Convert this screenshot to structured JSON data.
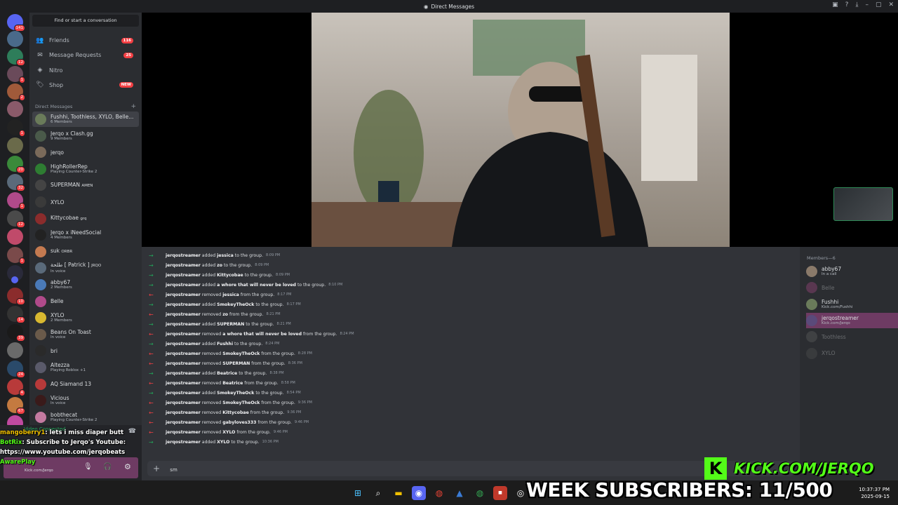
{
  "window": {
    "title": "Direct Messages"
  },
  "find_placeholder": "Find or start a conversation",
  "nav": [
    {
      "label": "Friends",
      "count": "116",
      "icon": "friends-icon"
    },
    {
      "label": "Message Requests",
      "count": "25",
      "icon": "inbox-icon"
    },
    {
      "label": "Nitro",
      "count": "",
      "icon": "nitro-icon"
    },
    {
      "label": "Shop",
      "count": "NEW",
      "icon": "shop-icon"
    }
  ],
  "dm_header": "Direct Messages",
  "dms": [
    {
      "name": "Fushhi, Toothless, XYLO, Belle...",
      "sub": "6 Members",
      "color": "#6a7b5a"
    },
    {
      "name": "Jerqo x Clash.gg",
      "sub": "9 Members",
      "color": "#4a5a4a"
    },
    {
      "name": "jerqo",
      "sub": "",
      "color": "#7a6a5a"
    },
    {
      "name": "HighRollerRep",
      "sub": "Playing Counter-Strike 2",
      "color": "#2e7d32"
    },
    {
      "name": "SUPERMAN",
      "sub": "",
      "tag": "AMEN",
      "color": "#444"
    },
    {
      "name": "XYLO",
      "sub": "",
      "color": "#3a3a3a"
    },
    {
      "name": "Kittycobae",
      "sub": "",
      "tag": "grq",
      "color": "#8b2c2c"
    },
    {
      "name": "Jerqo x iNeedSocial",
      "sub": "4 Members",
      "color": "#222"
    },
    {
      "name": "suk",
      "sub": "",
      "tag": "ORBR",
      "color": "#c47a50"
    },
    {
      "name": "ﻃﻠﺤﺔ [ Patrick ]",
      "sub": "In voice",
      "tag": "JRQO",
      "color": "#5a6a7a"
    },
    {
      "name": "abby67",
      "sub": "2 Members",
      "color": "#4a7ab8"
    },
    {
      "name": "Belle",
      "sub": "",
      "color": "#b04a8a"
    },
    {
      "name": "XYLO",
      "sub": "2 Members",
      "color": "#d8b830"
    },
    {
      "name": "Beans On Toast",
      "sub": "In voice",
      "color": "#6a5a4a"
    },
    {
      "name": "bri",
      "sub": "",
      "color": "#2a2a2a"
    },
    {
      "name": "Altezza",
      "sub": "Playing Roblox +1",
      "color": "#5a5a6a"
    },
    {
      "name": "AQ Siamand 13",
      "sub": "",
      "color": "#b83a3a"
    },
    {
      "name": "Vicious",
      "sub": "In voice",
      "color": "#3a1a1a"
    },
    {
      "name": "bobthecat",
      "sub": "Playing Counter-Strike 2",
      "color": "#c47aa0"
    }
  ],
  "guild_badges": [
    "141",
    "",
    "12",
    "1",
    "2",
    "",
    "1",
    "",
    "20",
    "32",
    "1",
    "12",
    "",
    "1",
    "",
    "",
    "10",
    "14",
    "39",
    "",
    "24",
    "4",
    "67",
    ""
  ],
  "userbar": {
    "status": "Video Connected",
    "user_sub": "Kick.com/Jerqo"
  },
  "stream_chat": [
    {
      "user": "mangoberry1",
      "msg": ": lets i miss diaper butt"
    },
    {
      "user": "BotRix",
      "msg": ": Subscribe to Jerqo's Youtube:"
    },
    {
      "user": "",
      "msg": "https://www.youtube.com/jerqobeats"
    },
    {
      "user": "AwarePlay",
      "msg": ""
    }
  ],
  "log": [
    {
      "type": "add",
      "actor": "jerqostreamer",
      "verb": "added",
      "target": "jessica",
      "rest": "to the group.",
      "time": "8:09 PM"
    },
    {
      "type": "add",
      "actor": "jerqostreamer",
      "verb": "added",
      "target": "zo",
      "rest": "to the group.",
      "time": "8:09 PM"
    },
    {
      "type": "add",
      "actor": "jerqostreamer",
      "verb": "added",
      "target": "Kittycobae",
      "rest": "to the group.",
      "time": "8:09 PM"
    },
    {
      "type": "add",
      "actor": "jerqostreamer",
      "verb": "added",
      "target": "a whore that will never be loved",
      "rest": "to the group.",
      "time": "8:10 PM"
    },
    {
      "type": "rem",
      "actor": "jerqostreamer",
      "verb": "removed",
      "target": "jessica",
      "rest": "from the group.",
      "time": "8:17 PM"
    },
    {
      "type": "add",
      "actor": "jerqostreamer",
      "verb": "added",
      "target": "SmokeyTheOck",
      "rest": "to the group.",
      "time": "8:17 PM"
    },
    {
      "type": "rem",
      "actor": "jerqostreamer",
      "verb": "removed",
      "target": "zo",
      "rest": "from the group.",
      "time": "8:21 PM"
    },
    {
      "type": "add",
      "actor": "jerqostreamer",
      "verb": "added",
      "target": "SUPERMAN",
      "rest": "to the group.",
      "time": "8:21 PM"
    },
    {
      "type": "rem",
      "actor": "jerqostreamer",
      "verb": "removed",
      "target": "a whore that will never be loved",
      "rest": "from the group.",
      "time": "8:24 PM"
    },
    {
      "type": "add",
      "actor": "jerqostreamer",
      "verb": "added",
      "target": "Fushhi",
      "rest": "to the group.",
      "time": "8:24 PM"
    },
    {
      "type": "rem",
      "actor": "jerqostreamer",
      "verb": "removed",
      "target": "SmokeyTheOck",
      "rest": "from the group.",
      "time": "8:28 PM"
    },
    {
      "type": "rem",
      "actor": "jerqostreamer",
      "verb": "removed",
      "target": "SUPERMAN",
      "rest": "from the group.",
      "time": "8:36 PM"
    },
    {
      "type": "add",
      "actor": "jerqostreamer",
      "verb": "added",
      "target": "Beatrice",
      "rest": "to the group.",
      "time": "8:38 PM"
    },
    {
      "type": "rem",
      "actor": "jerqostreamer",
      "verb": "removed",
      "target": "Beatrice",
      "rest": "from the group.",
      "time": "8:58 PM"
    },
    {
      "type": "add",
      "actor": "jerqostreamer",
      "verb": "added",
      "target": "SmokeyTheOck",
      "rest": "to the group.",
      "time": "8:54 PM"
    },
    {
      "type": "rem",
      "actor": "jerqostreamer",
      "verb": "removed",
      "target": "SmokeyTheOck",
      "rest": "from the group.",
      "time": "9:36 PM"
    },
    {
      "type": "rem",
      "actor": "jerqostreamer",
      "verb": "removed",
      "target": "Kittycobae",
      "rest": "from the group.",
      "time": "9:36 PM"
    },
    {
      "type": "rem",
      "actor": "jerqostreamer",
      "verb": "removed",
      "target": "gabyloves333",
      "rest": "from the group.",
      "time": "9:46 PM"
    },
    {
      "type": "rem",
      "actor": "jerqostreamer",
      "verb": "removed",
      "target": "XYLO",
      "rest": "from the group.",
      "time": "9:46 PM"
    },
    {
      "type": "add",
      "actor": "jerqostreamer",
      "verb": "added",
      "target": "XYLO",
      "rest": "to the group.",
      "time": "10:36 PM"
    }
  ],
  "members_header": "Members—6",
  "members": [
    {
      "name": "abby67",
      "sub": "In a call",
      "off": false,
      "color": "#8a7a6a"
    },
    {
      "name": "Belle",
      "sub": "",
      "off": true,
      "color": "#b04a8a"
    },
    {
      "name": "Fushhi",
      "sub": "Kick.com/Fushhi",
      "off": false,
      "color": "#6a7b5a"
    },
    {
      "name": "jerqostreamer",
      "sub": "Kick.com/Jerqo",
      "off": false,
      "color": "#5a4a7a"
    },
    {
      "name": "Toothless",
      "sub": "",
      "off": true,
      "color": "#666"
    },
    {
      "name": "XYLO",
      "sub": "",
      "off": true,
      "color": "#555"
    }
  ],
  "input": {
    "value": "sm"
  },
  "overlay": {
    "kick": "KICK.COM/JERQO",
    "kick_letter": "K",
    "subs": "WEEK SUBSCRIBERS: 11/500"
  },
  "clock": {
    "time": "10:37:37 PM",
    "date": "2025-09-15"
  }
}
